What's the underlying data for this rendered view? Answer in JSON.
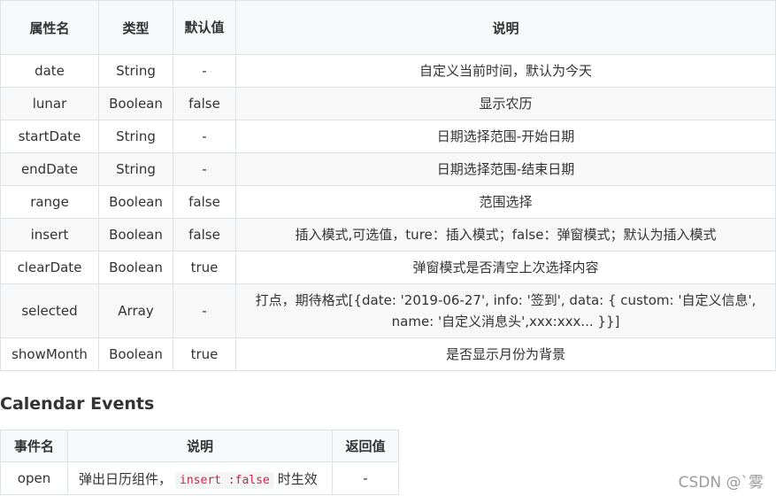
{
  "props_table": {
    "headers": {
      "name": "属性名",
      "type": "类型",
      "default": "默认值",
      "desc": "说明"
    },
    "rows": [
      {
        "name": "date",
        "type": "String",
        "default": "-",
        "desc": "自定义当前时间，默认为今天"
      },
      {
        "name": "lunar",
        "type": "Boolean",
        "default": "false",
        "desc": "显示农历"
      },
      {
        "name": "startDate",
        "type": "String",
        "default": "-",
        "desc": "日期选择范围-开始日期"
      },
      {
        "name": "endDate",
        "type": "String",
        "default": "-",
        "desc": "日期选择范围-结束日期"
      },
      {
        "name": "range",
        "type": "Boolean",
        "default": "false",
        "desc": "范围选择"
      },
      {
        "name": "insert",
        "type": "Boolean",
        "default": "false",
        "desc": "插入模式,可选值，ture：插入模式；false：弹窗模式；默认为插入模式"
      },
      {
        "name": "clearDate",
        "type": "Boolean",
        "default": "true",
        "desc": "弹窗模式是否清空上次选择内容"
      },
      {
        "name": "selected",
        "type": "Array",
        "default": "-",
        "desc": "打点，期待格式[{date: '2019-06-27', info: '签到', data: { custom: '自定义信息', name: '自定义消息头',xxx:xxx... }}]"
      },
      {
        "name": "showMonth",
        "type": "Boolean",
        "default": "true",
        "desc": "是否显示月份为背景"
      }
    ]
  },
  "events_heading": "Calendar Events",
  "events_table": {
    "headers": {
      "name": "事件名",
      "desc": "说明",
      "return": "返回值"
    },
    "rows": [
      {
        "name": "open",
        "desc_before": "弹出日历组件，",
        "desc_code": "insert :false",
        "desc_after": "时生效",
        "return": "-"
      }
    ]
  },
  "watermark": "CSDN @`雾"
}
